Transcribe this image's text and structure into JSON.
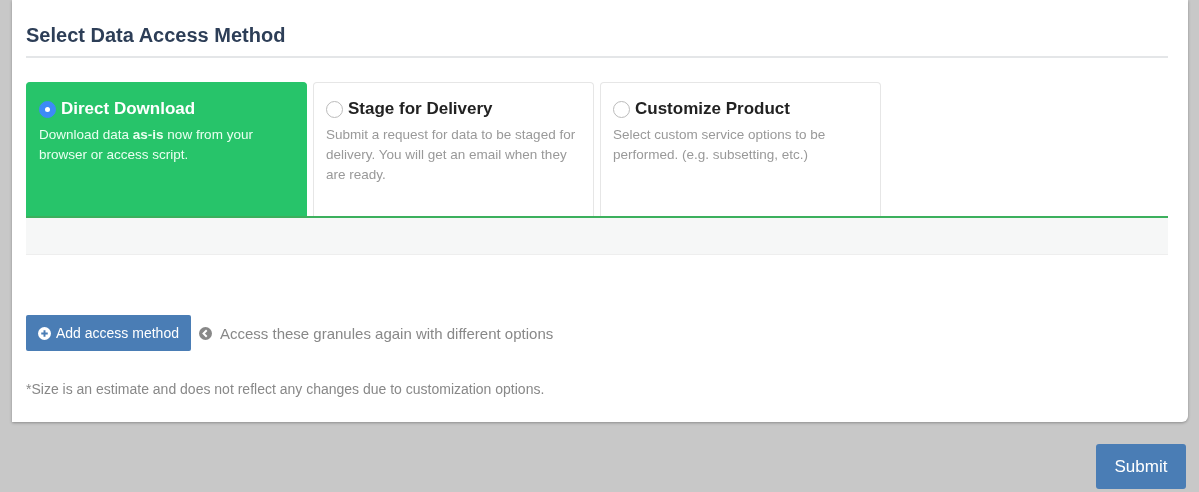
{
  "heading": "Select Data Access Method",
  "methods": [
    {
      "title": "Direct Download",
      "description": "Download data **as-is** now from your browser or access script.",
      "selected": true
    },
    {
      "title": "Stage for Delivery",
      "description": "Submit a request for data to be staged for delivery. You will get an email when they are ready.",
      "selected": false
    },
    {
      "title": "Customize Product",
      "description": "Select custom service options to be performed. (e.g. subsetting, etc.)",
      "selected": false
    }
  ],
  "add_button": "Add access method",
  "add_hint": "Access these granules again with different options",
  "footnote": "*Size is an estimate and does not reflect any changes due to customization options.",
  "submit_button": "Submit"
}
